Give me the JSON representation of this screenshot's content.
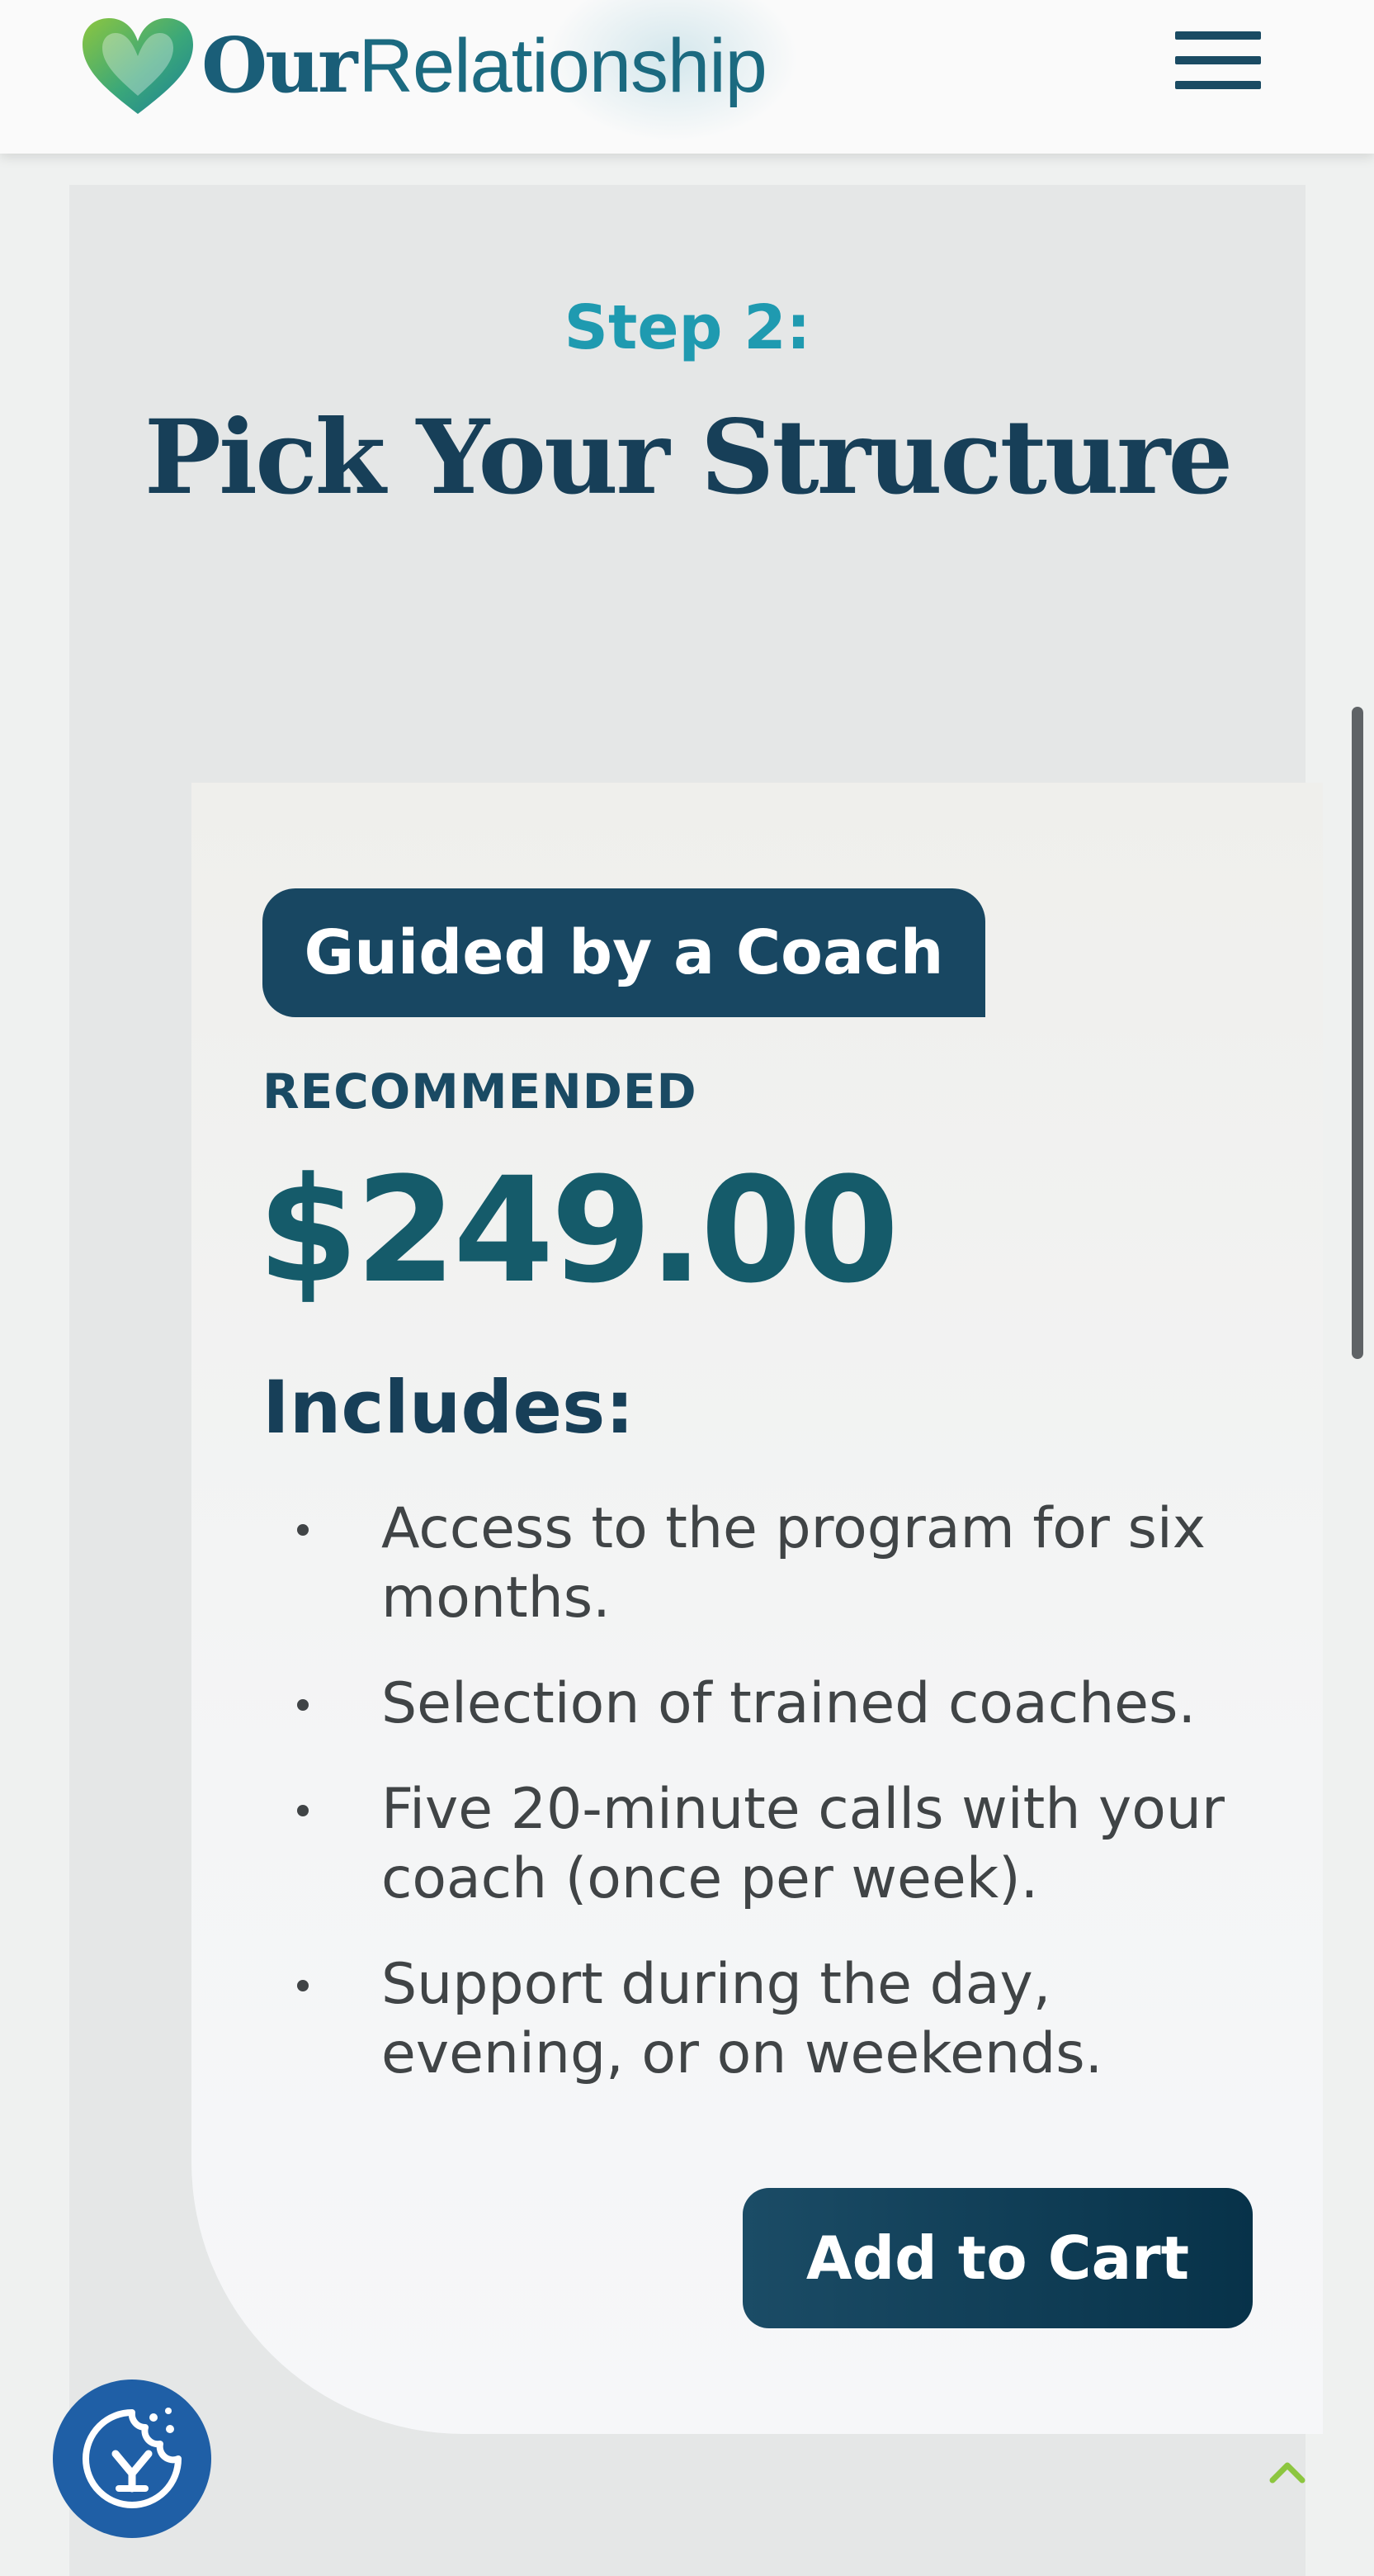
{
  "header": {
    "logo_our": "Our",
    "logo_relationship": "Relationship",
    "menu_icon": "hamburger-menu-icon"
  },
  "section": {
    "step_label": "Step 2:",
    "title": "Pick Your Structure"
  },
  "plan": {
    "badge": "Guided by a Coach",
    "tag": "RECOMMENDED",
    "price": "$249.00",
    "includes_heading": "Includes:",
    "features": [
      "Access to the program for six months.",
      "Selection of trained coaches.",
      "Five 20-minute calls with your coach (once per week).",
      "Support during the day, evening, or on weekends."
    ],
    "cta_label": "Add to Cart"
  },
  "floating": {
    "cookie_icon": "cookie-consent-icon",
    "back_to_top_icon": "chevron-up-icon"
  },
  "colors": {
    "brand_navy": "#184762",
    "brand_teal": "#1f9ab0",
    "price_teal": "#155b6a",
    "fab_blue": "#1f5fa6",
    "logo_green": "#7cc242"
  }
}
